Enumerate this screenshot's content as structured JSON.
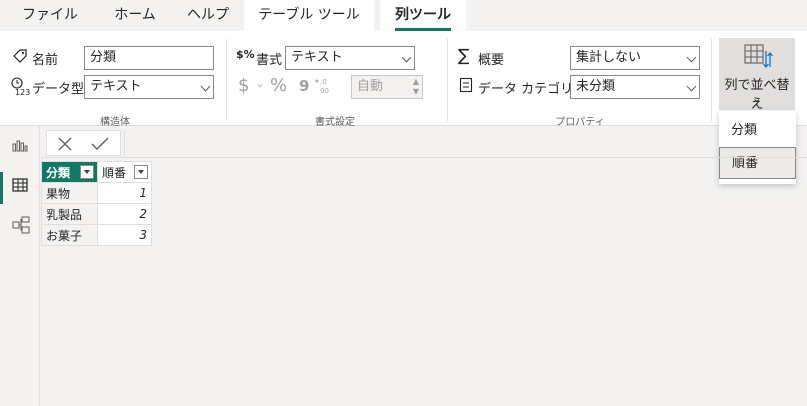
{
  "tabs": [
    {
      "label": "ファイル"
    },
    {
      "label": "ホーム"
    },
    {
      "label": "ヘルプ"
    },
    {
      "label": "テーブル ツール"
    },
    {
      "label": "列ツール"
    }
  ],
  "structure": {
    "name_label": "名前",
    "name_value": "分類",
    "datatype_label": "データ型",
    "datatype_value": "テキスト",
    "group_label": "構造体"
  },
  "format": {
    "format_label": "書式",
    "format_value": "テキスト",
    "currency_symbol": "$",
    "percent_symbol": "%",
    "comma_symbol": "9",
    "auto_value": "自動",
    "group_label": "書式設定"
  },
  "properties": {
    "summary_label": "概要",
    "summary_value": "集計しない",
    "category_label": "データ カテゴリ",
    "category_value": "未分類",
    "group_label": "プロパティ"
  },
  "sort": {
    "button_label": "列で並べ替え",
    "options": [
      "分類",
      "順番"
    ],
    "selected": "順番"
  },
  "table": {
    "headers": [
      "分類",
      "順番"
    ],
    "rows": [
      [
        "果物",
        "1"
      ],
      [
        "乳製品",
        "2"
      ],
      [
        "お菓子",
        "3"
      ]
    ]
  },
  "colors": {
    "accent": "#117865"
  }
}
